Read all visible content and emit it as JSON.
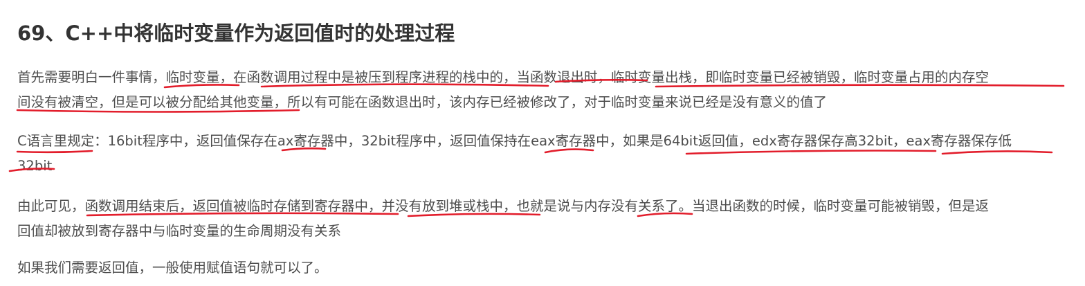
{
  "article": {
    "title": "69、C++中将临时变量作为返回值时的处理过程",
    "paragraphs": [
      {
        "lines": [
          "首先需要明白一件事情，临时变量，在函数调用过程中是被压到程序进程的栈中的，当函数退出时，临时变量出栈，即临时变量已经被销毁，临时变量占用的内存空",
          "间没有被清空，但是可以被分配给其他变量，所以有可能在函数退出时，该内存已经被修改了，对于临时变量来说已经是没有意义的值了"
        ]
      },
      {
        "lines": [
          "C语言里规定：16bit程序中，返回值保存在ax寄存器中，32bit程序中，返回值保持在eax寄存器中，如果是64bit返回值，edx寄存器保存高32bit，eax寄存器保存低",
          "32bit"
        ]
      },
      {
        "lines": [
          "由此可见，函数调用结束后，返回值被临时存储到寄存器中，并没有放到堆或栈中，也就是说与内存没有关系了。当退出函数的时候，临时变量可能被销毁，但是返",
          "回值却被放到寄存器中与临时变量的生命周期没有关系"
        ]
      },
      {
        "lines": [
          "如果我们需要返回值，一般使用赋值语句就可以了。"
        ]
      }
    ]
  },
  "annotation_color": "#e21d2b"
}
